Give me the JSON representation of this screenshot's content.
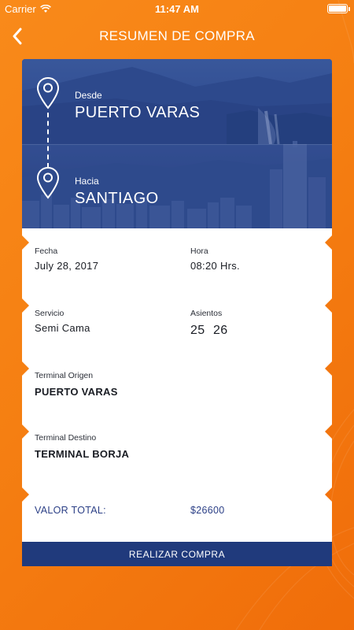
{
  "status_bar": {
    "carrier": "Carrier",
    "time": "11:47 AM"
  },
  "nav": {
    "title": "RESUMEN DE COMPRA"
  },
  "route": {
    "from_label": "Desde",
    "from_city": "PUERTO VARAS",
    "to_label": "Hacia",
    "to_city": "SANTIAGO"
  },
  "trip": {
    "date_label": "Fecha",
    "date_value": "July 28, 2017",
    "time_label": "Hora",
    "time_value": "08:20 Hrs.",
    "service_label": "Servicio",
    "service_value": "Semi Cama",
    "seats_label": "Asientos",
    "seats": [
      "25",
      "26"
    ]
  },
  "terminals": {
    "origin_label": "Terminal Origen",
    "origin_value": "PUERTO VARAS",
    "destination_label": "Terminal Destino",
    "destination_value": "TERMINAL BORJA"
  },
  "total": {
    "label": "VALOR TOTAL:",
    "value": "$26600"
  },
  "actions": {
    "buy_label": "REALIZAR COMPRA"
  },
  "colors": {
    "background": "#f57f12",
    "card_blue": "#2f4a86",
    "button_blue": "#203a7c",
    "total_text": "#2b3f86"
  }
}
